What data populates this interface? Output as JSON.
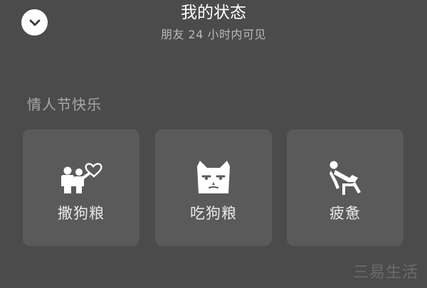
{
  "header": {
    "title": "我的状态",
    "subtitle": "朋友 24 小时内可见",
    "back_icon": "chevron-down-icon"
  },
  "section": {
    "title": "情人节快乐"
  },
  "cards": [
    {
      "label": "撒狗粮",
      "icon": "couple-heart-icon"
    },
    {
      "label": "吃狗粮",
      "icon": "cat-face-icon"
    },
    {
      "label": "疲惫",
      "icon": "tired-person-icon"
    }
  ],
  "watermark": "三易生活",
  "colors": {
    "background": "#4b4b4b",
    "card": "#5a5a5a",
    "text": "#ffffff",
    "muted_text": "#a7a7a7"
  }
}
